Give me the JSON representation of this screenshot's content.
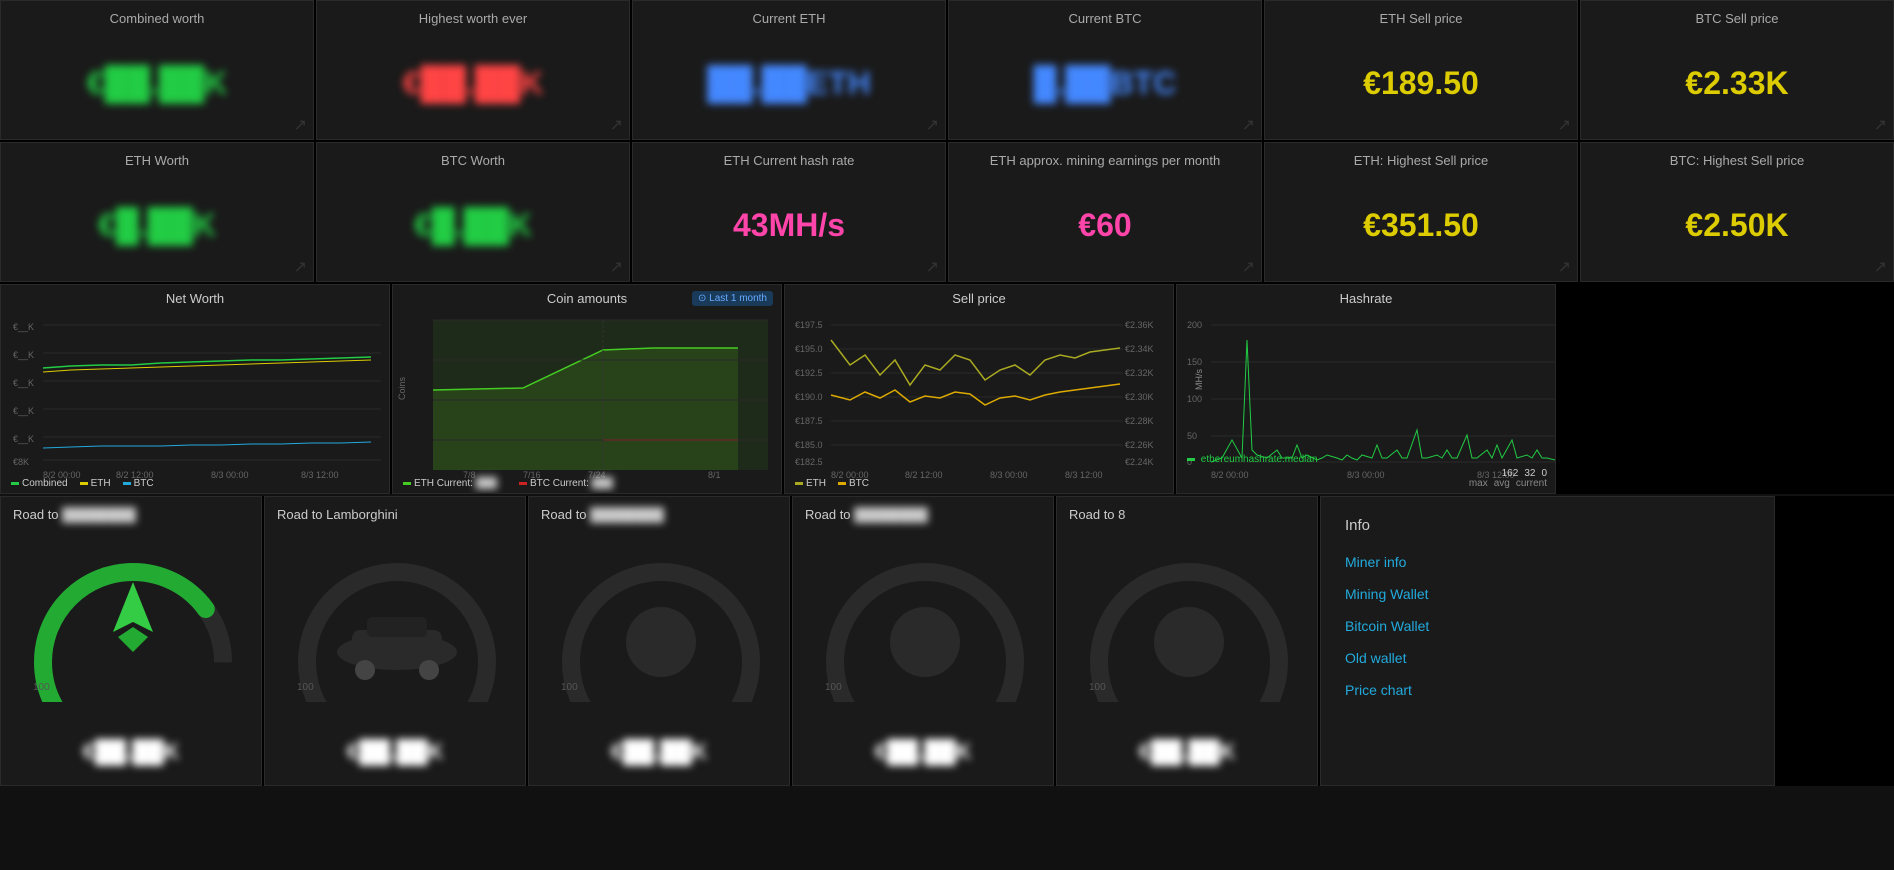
{
  "topStats": {
    "row1": [
      {
        "id": "combined-worth",
        "title": "Combined worth",
        "value": "€██.██K",
        "colorClass": "val-green",
        "blurred": true
      },
      {
        "id": "highest-worth",
        "title": "Highest worth ever",
        "value": "€██.██K",
        "colorClass": "val-red",
        "blurred": true
      },
      {
        "id": "current-eth",
        "title": "Current ETH",
        "value": "██.██ETH",
        "colorClass": "val-blue",
        "blurred": true
      },
      {
        "id": "current-btc",
        "title": "Current BTC",
        "value": "█.██BTC",
        "colorClass": "val-blue",
        "blurred": true
      },
      {
        "id": "eth-sell-price",
        "title": "ETH Sell price",
        "value": "€189.50",
        "colorClass": "val-yellow",
        "blurred": false
      },
      {
        "id": "btc-sell-price",
        "title": "BTC Sell price",
        "value": "€2.33K",
        "colorClass": "val-yellow",
        "blurred": false
      }
    ],
    "row2": [
      {
        "id": "eth-worth",
        "title": "ETH Worth",
        "value": "€█.██K",
        "colorClass": "val-green",
        "blurred": true
      },
      {
        "id": "btc-worth",
        "title": "BTC Worth",
        "value": "€█.██K",
        "colorClass": "val-green",
        "blurred": true
      },
      {
        "id": "eth-hashrate",
        "title": "ETH Current hash rate",
        "value": "43MH/s",
        "colorClass": "val-pink",
        "blurred": false
      },
      {
        "id": "eth-mining",
        "title": "ETH approx. mining earnings per month",
        "value": "€60",
        "colorClass": "val-pink",
        "blurred": false
      },
      {
        "id": "eth-highest-sell",
        "title": "ETH: Highest Sell price",
        "value": "€351.50",
        "colorClass": "val-yellow",
        "blurred": false
      },
      {
        "id": "btc-highest-sell",
        "title": "BTC: Highest Sell price",
        "value": "€2.50K",
        "colorClass": "val-yellow",
        "blurred": false
      }
    ]
  },
  "charts": {
    "netWorth": {
      "title": "Net Worth",
      "yLabels": [
        "€__K",
        "€__K",
        "€__K",
        "€__K",
        "€__K",
        "€8K"
      ],
      "xLabels": [
        "8/2 00:00",
        "8/2 12:00",
        "8/3 00:00",
        "8/3 12:00"
      ],
      "legend": [
        {
          "label": "Combined",
          "color": "#22cc44"
        },
        {
          "label": "ETH",
          "color": "#ddcc00"
        },
        {
          "label": "BTC",
          "color": "#22aadd"
        }
      ]
    },
    "coinAmounts": {
      "title": "Coin amounts",
      "badge": "⊙ Last 1 month",
      "xLabels": [
        "7/8",
        "7/16",
        "7/24",
        "8/1"
      ],
      "yLabel": "Coins",
      "legend": [
        {
          "label": "ETH  Current:",
          "color": "#22cc44",
          "valueBlurred": true
        },
        {
          "label": "BTC  Current:",
          "color": "#cc2222",
          "valueBlurred": true
        }
      ]
    },
    "sellPrice": {
      "title": "Sell price",
      "leftLabels": [
        "€197.5",
        "€195.0",
        "€192.5",
        "€190.0",
        "€187.5",
        "€185.0",
        "€182.5"
      ],
      "rightLabels": [
        "€2.36K",
        "€2.34K",
        "€2.32K",
        "€2.30K",
        "€2.28K",
        "€2.26K",
        "€2.24K"
      ],
      "xLabels": [
        "8/2 00:00",
        "8/2 12:00",
        "8/3 00:00",
        "8/3 12:00"
      ],
      "legend": [
        {
          "label": "ETH",
          "color": "#ddcc00"
        },
        {
          "label": "BTC",
          "color": "#ddcc00"
        }
      ]
    },
    "hashrate": {
      "title": "Hashrate",
      "yLabels": [
        "200",
        "150",
        "100",
        "50",
        "0"
      ],
      "yAxisLabel": "MH/s",
      "xLabels": [
        "8/2 00:00",
        "8/3 00:00",
        "8/3 12:00"
      ],
      "legend": {
        "label": "ethereumhashrate.median",
        "color": "#22cc44"
      },
      "stats": [
        {
          "label": "max",
          "value": "162"
        },
        {
          "label": "avg",
          "value": "32"
        },
        {
          "label": "current",
          "value": "0"
        }
      ]
    }
  },
  "roadCards": [
    {
      "id": "road1",
      "title": "Road to",
      "titleBlurred": true,
      "value": "€██.██K",
      "blurred": true,
      "hasGreen": true
    },
    {
      "id": "road2",
      "title": "Road to Lamborghini",
      "value": "€██.██K",
      "blurred": true,
      "hasGreen": false
    },
    {
      "id": "road3",
      "title": "Road to",
      "titleBlurred": true,
      "value": "€██.██K",
      "blurred": true,
      "hasGreen": false
    },
    {
      "id": "road4",
      "title": "Road to",
      "titleBlurred": true,
      "value": "€██.██K",
      "blurred": true,
      "hasGreen": false
    },
    {
      "id": "road5",
      "title": "Road to 8",
      "value": "€██.██K",
      "blurred": false,
      "hasGreen": false,
      "hidden": true
    }
  ],
  "info": {
    "title": "Info",
    "links": [
      {
        "id": "miner-info",
        "label": "Miner info"
      },
      {
        "id": "mining-wallet",
        "label": "Mining Wallet"
      },
      {
        "id": "bitcoin-wallet",
        "label": "Bitcoin Wallet"
      },
      {
        "id": "old-wallet",
        "label": "Old wallet"
      },
      {
        "id": "price-chart",
        "label": "Price chart"
      }
    ]
  }
}
